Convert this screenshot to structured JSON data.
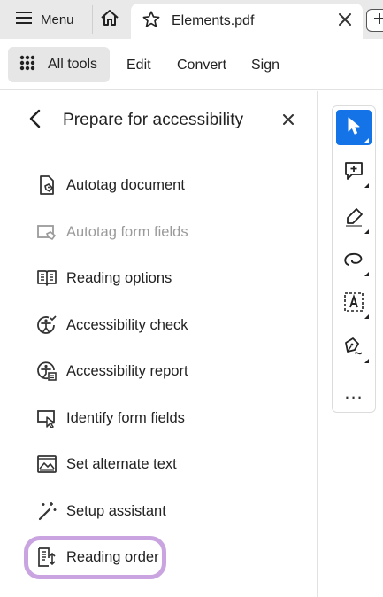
{
  "tabbar": {
    "menu_label": "Menu",
    "doc_tab_title": "Elements.pdf"
  },
  "toolbar": {
    "all_tools_label": "All tools",
    "links": [
      "Edit",
      "Convert",
      "Sign"
    ]
  },
  "panel": {
    "title": "Prepare for accessibility",
    "items": [
      {
        "label": "Autotag document",
        "icon": "autotag-document-icon",
        "enabled": true
      },
      {
        "label": "Autotag form fields",
        "icon": "autotag-form-fields-icon",
        "enabled": false
      },
      {
        "label": "Reading options",
        "icon": "book-icon",
        "enabled": true
      },
      {
        "label": "Accessibility check",
        "icon": "accessibility-check-icon",
        "enabled": true
      },
      {
        "label": "Accessibility report",
        "icon": "accessibility-report-icon",
        "enabled": true
      },
      {
        "label": "Identify form fields",
        "icon": "identify-form-fields-icon",
        "enabled": true
      },
      {
        "label": "Set alternate text",
        "icon": "image-alt-text-icon",
        "enabled": true
      },
      {
        "label": "Setup assistant",
        "icon": "magic-wand-icon",
        "enabled": true
      },
      {
        "label": "Reading order",
        "icon": "reading-order-icon",
        "enabled": true,
        "highlighted": true
      }
    ]
  },
  "quick_tools": {
    "items": [
      "select-cursor-icon",
      "add-comment-icon",
      "highlight-pen-icon",
      "lasso-draw-icon",
      "text-select-icon",
      "sign-pen-icon"
    ],
    "active": "select-cursor-icon",
    "more_label": "..."
  },
  "colors": {
    "accent": "#1473e6",
    "highlight_ring": "#c9a4e0",
    "disabled_text": "#9a9a9a"
  }
}
